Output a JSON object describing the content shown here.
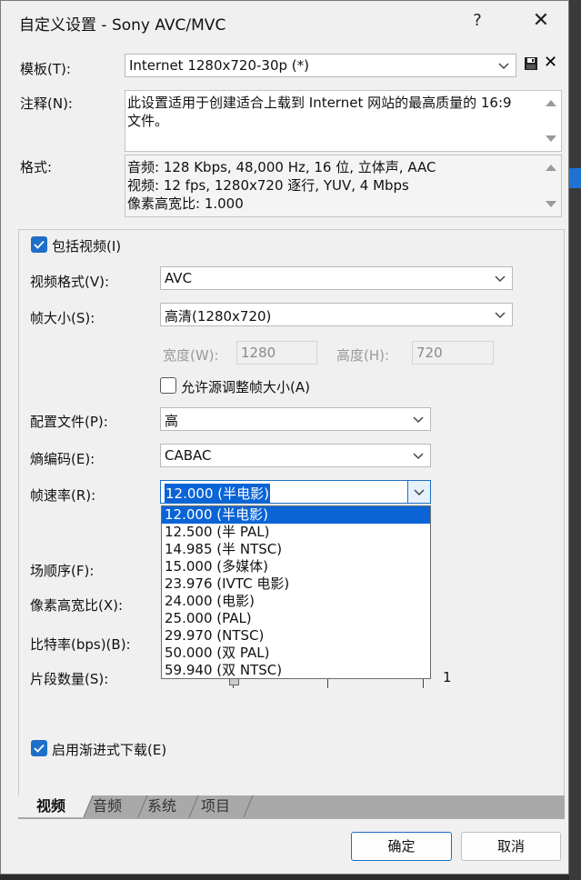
{
  "window": {
    "title": "自定义设置 - Sony AVC/MVC",
    "help_glyph": "?",
    "close_glyph": "✕"
  },
  "template": {
    "label": "模板(T):",
    "value": "Internet 1280x720-30p (*)",
    "save_icon": "save-icon",
    "delete_glyph": "✕"
  },
  "notes": {
    "label": "注释(N):",
    "line1": "此设置适用于创建适合上载到 Internet 网站的最高质量的 16:9",
    "line2": "文件。"
  },
  "format": {
    "label": "格式:",
    "line1": "音频: 128 Kbps, 48,000 Hz, 16 位, 立体声, AAC",
    "line2": "视频: 12 fps, 1280x720 逐行, YUV, 4 Mbps",
    "line3": "像素高宽比: 1.000"
  },
  "video": {
    "include_label": "包括视频(I)",
    "include_checked": true,
    "format_label": "视频格式(V):",
    "format_value": "AVC",
    "frame_size_label": "帧大小(S):",
    "frame_size_value": "高清(1280x720)",
    "width_label": "宽度(W):",
    "width_value": "1280",
    "height_label": "高度(H):",
    "height_value": "720",
    "allow_resize_label": "允许源调整帧大小(A)",
    "allow_resize_checked": false,
    "profile_label": "配置文件(P):",
    "profile_value": "高",
    "entropy_label": "熵编码(E):",
    "entropy_value": "CABAC",
    "framerate_label": "帧速率(R):",
    "framerate_value": "12.000 (半电影)",
    "field_order_label": "场顺序(F):",
    "pixel_aspect_label": "像素高宽比(X):",
    "bitrate_label": "比特率(bps)(B):",
    "slices_label": "片段数量(S):",
    "slices_max": "1",
    "progressive_label": "启用渐进式下载(E)",
    "progressive_checked": true
  },
  "framerate_options": [
    "12.000 (半电影)",
    "12.500 (半 PAL)",
    "14.985 (半 NTSC)",
    "15.000 (多媒体)",
    "23.976 (IVTC 电影)",
    "24.000 (电影)",
    "25.000 (PAL)",
    "29.970 (NTSC)",
    "50.000 (双 PAL)",
    "59.940 (双 NTSC)"
  ],
  "tabs": [
    "视频",
    "音频",
    "系统",
    "项目"
  ],
  "buttons": {
    "ok": "确定",
    "cancel": "取消"
  },
  "colors": {
    "accent": "#1e6fc7",
    "selection": "#0a64d6"
  }
}
